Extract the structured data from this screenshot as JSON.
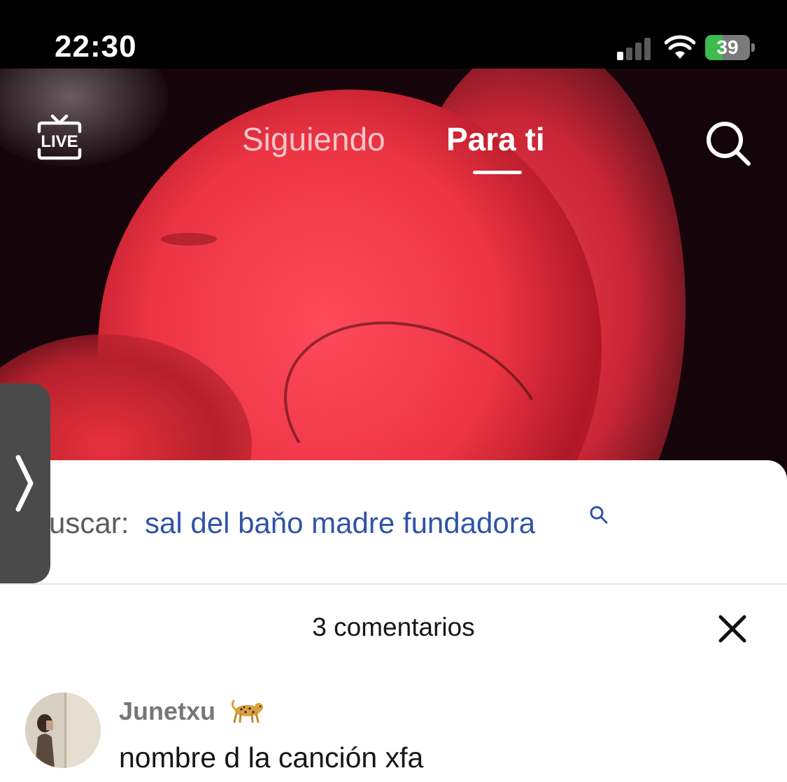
{
  "status_bar": {
    "time": "22:30",
    "battery": "39",
    "battery_level": 0.39
  },
  "top_nav": {
    "live_label": "LIVE",
    "tabs": [
      {
        "label": "Siguiendo",
        "active": false
      },
      {
        "label": "Para ti",
        "active": true
      }
    ]
  },
  "search_suggestion": {
    "prefix": "uscar:",
    "query": "sal del baňo madre fundadora"
  },
  "comments": {
    "title": "3 comentarios",
    "items": [
      {
        "username": "Junetxu",
        "username_emoji": "leopard-emoji",
        "text": "nombre d la canción xfa"
      }
    ]
  },
  "colors": {
    "link_blue": "#2f53a5",
    "video_red": "#ec3443",
    "battery_green": "#3dbb4f"
  }
}
